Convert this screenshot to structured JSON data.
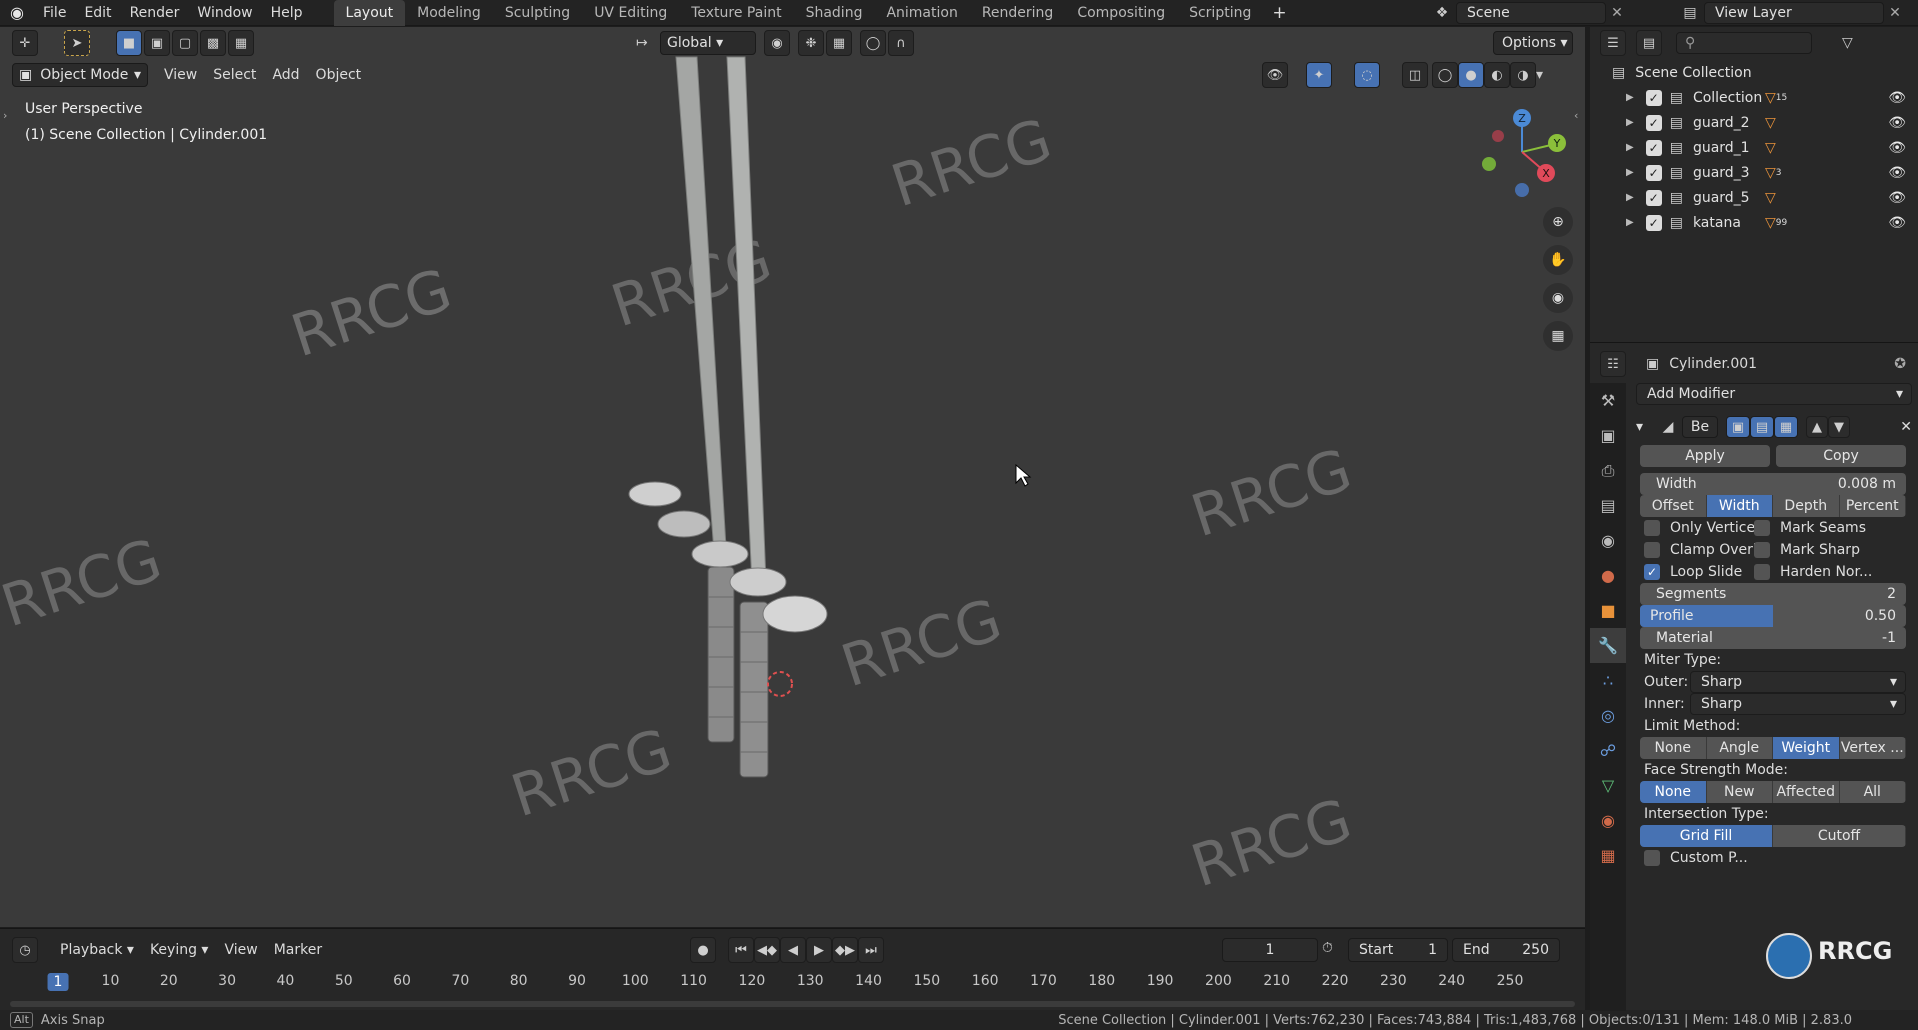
{
  "menu": [
    "File",
    "Edit",
    "Render",
    "Window",
    "Help"
  ],
  "workspaces": [
    {
      "label": "Layout",
      "active": true
    },
    {
      "label": "Modeling",
      "active": false
    },
    {
      "label": "Sculpting",
      "active": false
    },
    {
      "label": "UV Editing",
      "active": false
    },
    {
      "label": "Texture Paint",
      "active": false
    },
    {
      "label": "Shading",
      "active": false
    },
    {
      "label": "Animation",
      "active": false
    },
    {
      "label": "Rendering",
      "active": false
    },
    {
      "label": "Compositing",
      "active": false
    },
    {
      "label": "Scripting",
      "active": false
    }
  ],
  "add_workspace": "+",
  "scene": {
    "label": "Scene"
  },
  "view_layer": {
    "label": "View Layer"
  },
  "viewport": {
    "transform_orientation": "Global",
    "options_label": "Options",
    "mode": "Object Mode",
    "menus": [
      "View",
      "Select",
      "Add",
      "Object"
    ],
    "overlay_title": "User Perspective",
    "overlay_subtitle": "(1) Scene Collection | Cylinder.001",
    "gizmo": {
      "z": "Z",
      "y": "Y",
      "x": "X"
    }
  },
  "outliner": {
    "root": "Scene Collection",
    "items": [
      {
        "label": "Collection",
        "badge": "15"
      },
      {
        "label": "guard_2",
        "badge": ""
      },
      {
        "label": "guard_1",
        "badge": ""
      },
      {
        "label": "guard_3",
        "badge": "3"
      },
      {
        "label": "guard_5",
        "badge": ""
      },
      {
        "label": "katana",
        "badge": "99"
      }
    ]
  },
  "properties": {
    "object_name": "Cylinder.001",
    "add_modifier": "Add Modifier",
    "modifier_name": "Be",
    "apply": "Apply",
    "copy": "Copy",
    "width_label": "Width",
    "width_value": "0.008 m",
    "width_type": [
      {
        "label": "Offset",
        "on": false
      },
      {
        "label": "Width",
        "on": true
      },
      {
        "label": "Depth",
        "on": false
      },
      {
        "label": "Percent",
        "on": false
      }
    ],
    "checks": [
      {
        "label": "Only Vertices",
        "on": false
      },
      {
        "label": "Mark Seams",
        "on": false
      },
      {
        "label": "Clamp Overl...",
        "on": false
      },
      {
        "label": "Mark Sharp",
        "on": false
      },
      {
        "label": "Loop Slide",
        "on": true
      },
      {
        "label": "Harden Nor...",
        "on": false
      }
    ],
    "segments_label": "Segments",
    "segments_value": "2",
    "profile_label": "Profile",
    "profile_value": "0.50",
    "profile_fraction": 0.5,
    "material_label": "Material",
    "material_value": "-1",
    "miter_label": "Miter Type:",
    "outer_label": "Outer:",
    "outer_value": "Sharp",
    "inner_label": "Inner:",
    "inner_value": "Sharp",
    "limit_label": "Limit Method:",
    "limit": [
      {
        "label": "None",
        "on": false
      },
      {
        "label": "Angle",
        "on": false
      },
      {
        "label": "Weight",
        "on": true
      },
      {
        "label": "Vertex ...",
        "on": false
      }
    ],
    "face_strength_label": "Face Strength Mode:",
    "face_strength": [
      {
        "label": "None",
        "on": true
      },
      {
        "label": "New",
        "on": false
      },
      {
        "label": "Affected",
        "on": false
      },
      {
        "label": "All",
        "on": false
      }
    ],
    "intersection_label": "Intersection Type:",
    "intersection": [
      {
        "label": "Grid Fill",
        "on": true
      },
      {
        "label": "Cutoff",
        "on": false
      }
    ],
    "custom_profile": "Custom P..."
  },
  "timeline": {
    "menus": [
      "Playback",
      "Keying",
      "View",
      "Marker"
    ],
    "current_frame": "1",
    "start_label": "Start",
    "start_value": "1",
    "end_label": "End",
    "end_value": "250",
    "ticks": [
      "1",
      "10",
      "20",
      "30",
      "40",
      "50",
      "60",
      "70",
      "80",
      "90",
      "100",
      "110",
      "120",
      "130",
      "140",
      "150",
      "160",
      "170",
      "180",
      "190",
      "200",
      "210",
      "220",
      "230",
      "240",
      "250"
    ]
  },
  "statusbar": {
    "key": "Alt",
    "hint": "Axis Snap",
    "stats": "Scene Collection | Cylinder.001 | Verts:762,230 | Faces:743,884 | Tris:1,483,768 | Objects:0/131 | Mem: 148.0 MiB | 2.83.0"
  },
  "watermark": "RRCG",
  "colors": {
    "accent": "#4772b3",
    "viewport_bg": "#3a3a3a",
    "panel_bg": "#282828"
  }
}
